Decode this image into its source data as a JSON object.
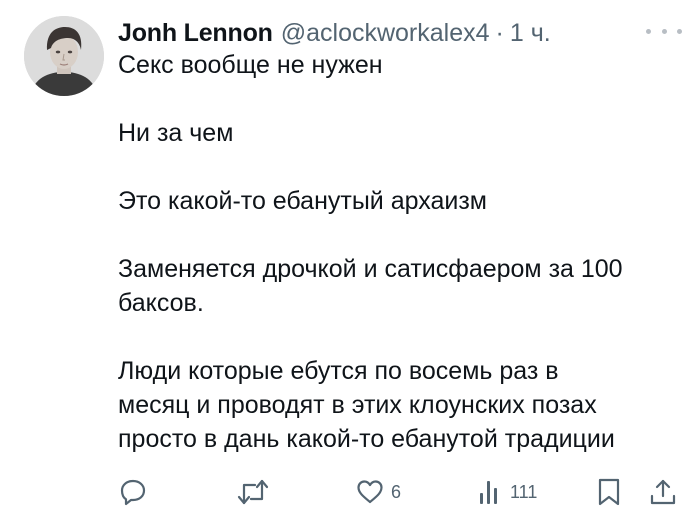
{
  "author": {
    "display_name": "Jonh Lennon",
    "handle": "@aclockworkalex4",
    "separator": "·",
    "time": "1 ч."
  },
  "tweet": {
    "paragraphs": [
      "Секс вообще не нужен",
      "Ни за чем",
      "Это какой-то ебанутый архаизм",
      "Заменяется дрочкой и сатисфаером за 100\nбаксов.",
      "Люди которые ебутся по восемь раз в\nмесяц и проводят в этих клоунских позах\nпросто в дань какой-то ебанутой традиции"
    ]
  },
  "actions": {
    "reply_icon": "reply-icon",
    "retweet_icon": "retweet-icon",
    "like_icon": "heart-icon",
    "like_count": "6",
    "views_icon": "views-chart-icon",
    "views_count": "111",
    "bookmark_icon": "bookmark-icon",
    "share_icon": "share-icon"
  },
  "menu": {
    "icon": "more-options-icon"
  },
  "colors": {
    "text": "#0f1419",
    "secondary": "#536471",
    "background": "#ffffff"
  }
}
